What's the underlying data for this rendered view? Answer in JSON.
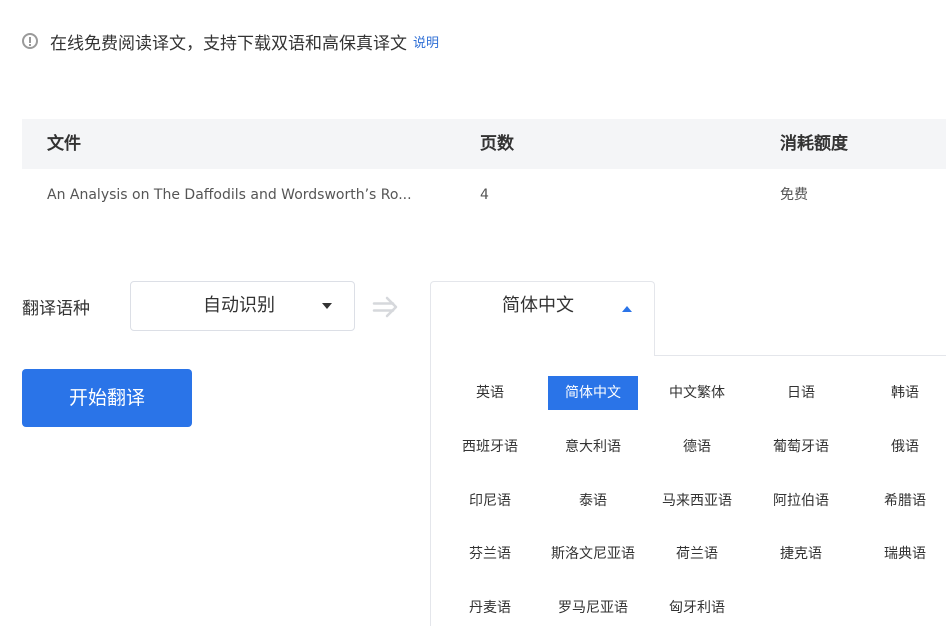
{
  "notice": {
    "icon": "info-icon",
    "text": "在线免费阅读译文，支持下载双语和高保真译文",
    "link": "说明"
  },
  "colors": {
    "accent": "#2a74e8",
    "link": "#2f6fd6",
    "table_header_bg": "#f4f5f7"
  },
  "table": {
    "headers": [
      "文件",
      "页数",
      "消耗额度"
    ],
    "rows": [
      {
        "file": "An Analysis on The Daffodils and Wordsworth’s Ro...",
        "pages": "4",
        "cost": "免费"
      }
    ]
  },
  "language": {
    "label": "翻译语种",
    "source": "自动识别",
    "swap_icon": "swap-arrow-icon",
    "target": "简体中文",
    "selected": "简体中文",
    "options": [
      [
        "英语",
        "简体中文",
        "中文繁体",
        "日语",
        "韩语"
      ],
      [
        "西班牙语",
        "意大利语",
        "德语",
        "葡萄牙语",
        "俄语"
      ],
      [
        "印尼语",
        "泰语",
        "马来西亚语",
        "阿拉伯语",
        "希腊语"
      ],
      [
        "芬兰语",
        "斯洛文尼亚语",
        "荷兰语",
        "捷克语",
        "瑞典语"
      ],
      [
        "丹麦语",
        "罗马尼亚语",
        "匈牙利语"
      ]
    ]
  },
  "actions": {
    "start": "开始翻译"
  }
}
